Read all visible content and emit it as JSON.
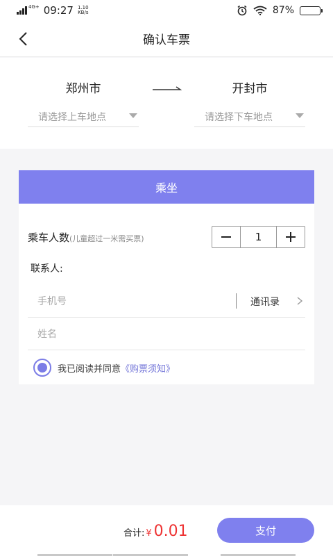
{
  "status_bar": {
    "network": "4G+",
    "time": "09:27",
    "speed_value": "1.10",
    "speed_unit": "KB/s",
    "battery": "87%",
    "battery_level": 0.87,
    "icons": [
      "signal-icon",
      "alarm-icon",
      "wifi-icon",
      "battery-icon"
    ]
  },
  "nav": {
    "title": "确认车票",
    "back_icon": "chevron-left-icon"
  },
  "route": {
    "from_city": "郑州市",
    "to_city": "开封市",
    "from_placeholder": "请选择上车地点",
    "to_placeholder": "请选择下车地点"
  },
  "ride": {
    "header": "乘坐",
    "pax_label": "乘车人数",
    "pax_hint": "(儿童超过一米需买票)",
    "pax_count": "1",
    "contact_label": "联系人:",
    "phone_placeholder": "手机号",
    "address_book": "通讯录",
    "name_placeholder": "姓名",
    "agree_text": "我已阅读并同意",
    "agree_link": "《购票须知》",
    "agree_checked": true
  },
  "footer": {
    "total_label": "合计:",
    "currency": "¥",
    "total_amount": "0.01",
    "pay_label": "支付"
  },
  "colors": {
    "accent": "#7f80ee",
    "price": "#ee3333",
    "link": "#7375d8"
  }
}
